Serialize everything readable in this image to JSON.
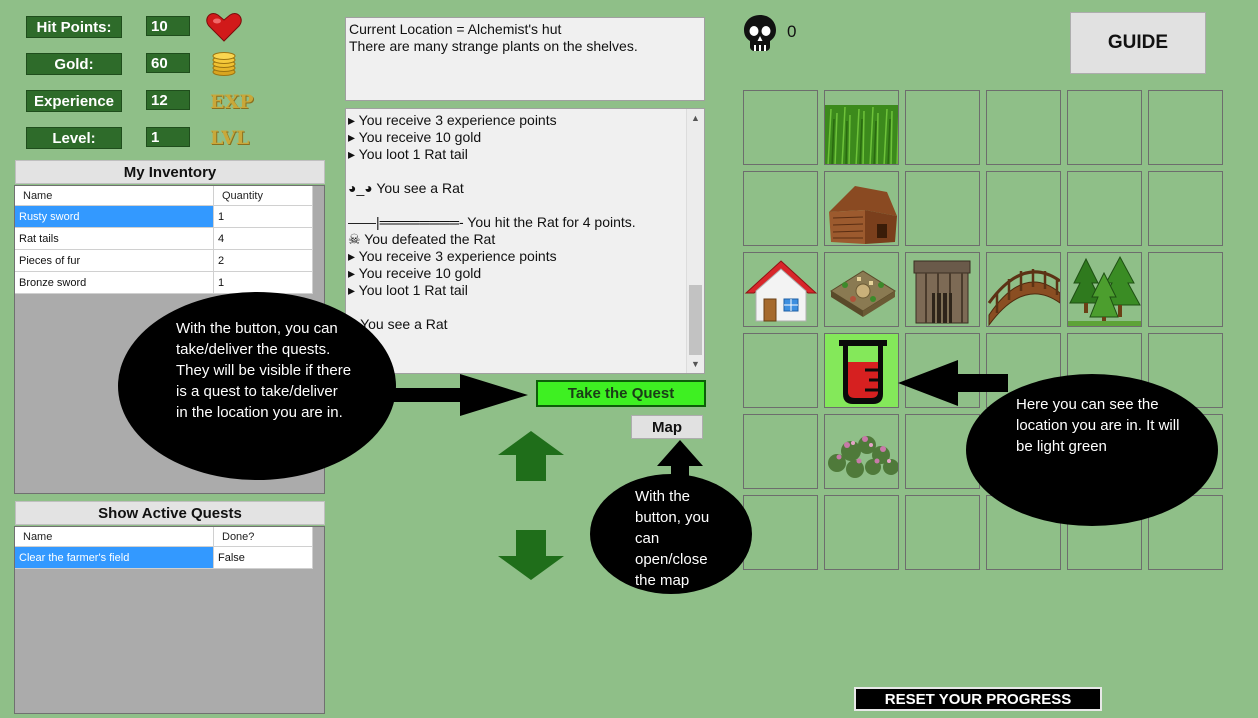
{
  "stats": {
    "hp_label": "Hit Points:",
    "hp_value": "10",
    "gold_label": "Gold:",
    "gold_value": "60",
    "exp_label": "Experience",
    "exp_value": "12",
    "exp_glyph": "EXP",
    "level_label": "Level:",
    "level_value": "1",
    "level_glyph": "LVL"
  },
  "kills": {
    "icon": "skull-icon",
    "count": "0"
  },
  "inventory": {
    "title": "My Inventory",
    "columns": [
      "Name",
      "Quantity"
    ],
    "rows": [
      {
        "name": "Rusty sword",
        "qty": "1"
      },
      {
        "name": "Rat tails",
        "qty": "4"
      },
      {
        "name": "Pieces of fur",
        "qty": "2"
      },
      {
        "name": "Bronze sword",
        "qty": "1"
      }
    ]
  },
  "quests": {
    "title": "Show Active Quests",
    "columns": [
      "Name",
      "Done?"
    ],
    "rows": [
      {
        "name": "Clear the farmer's field",
        "done": "False"
      }
    ]
  },
  "location": {
    "line1": "Current Location = Alchemist's hut",
    "line2": "There are many strange plants on the shelves."
  },
  "log": [
    "▸ You receive 3 experience points",
    "▸ You receive 10 gold",
    "▸ You loot 1 Rat tail",
    "",
    "◕_◕ You see a Rat",
    "",
    "——|════════- You hit the Rat for 4 points.",
    "☠ You defeated the Rat",
    "▸ You receive 3 experience points",
    "▸ You receive 10 gold",
    "▸ You loot 1 Rat tail",
    "",
    "◕ You see a Rat"
  ],
  "buttons": {
    "take_quest": "Take the Quest",
    "map": "Map",
    "guide": "GUIDE",
    "reset": "RESET YOUR PROGRESS"
  },
  "callouts": {
    "quest_button": "With the button, you can take/deliver the quests. They will be visible if there is a quest to take/deliver in the location you are in.",
    "map_button": "With the button, you can open/close the map",
    "location": "Here you can see the location you are in. It will be light green"
  },
  "map": {
    "tiles": [
      [
        "empty",
        "grass",
        "empty",
        "empty",
        "empty",
        "empty"
      ],
      [
        "empty",
        "farmhouse",
        "empty",
        "empty",
        "empty",
        "empty"
      ],
      [
        "home",
        "town-square",
        "guard-post",
        "bridge",
        "forest",
        "empty"
      ],
      [
        "empty",
        "alchemist-hut",
        "empty",
        "empty",
        "empty",
        "empty"
      ],
      [
        "empty",
        "herb-garden",
        "empty",
        "empty",
        "empty",
        "empty"
      ],
      [
        "empty",
        "empty",
        "empty",
        "empty",
        "empty",
        "empty"
      ]
    ],
    "current": "alchemist-hut",
    "current_color": "#84e85a"
  },
  "colors": {
    "background": "#8fbf88",
    "stat_box": "#2e6b2a",
    "quest_button": "#3ef022",
    "arrows": "#1f6e1a"
  }
}
